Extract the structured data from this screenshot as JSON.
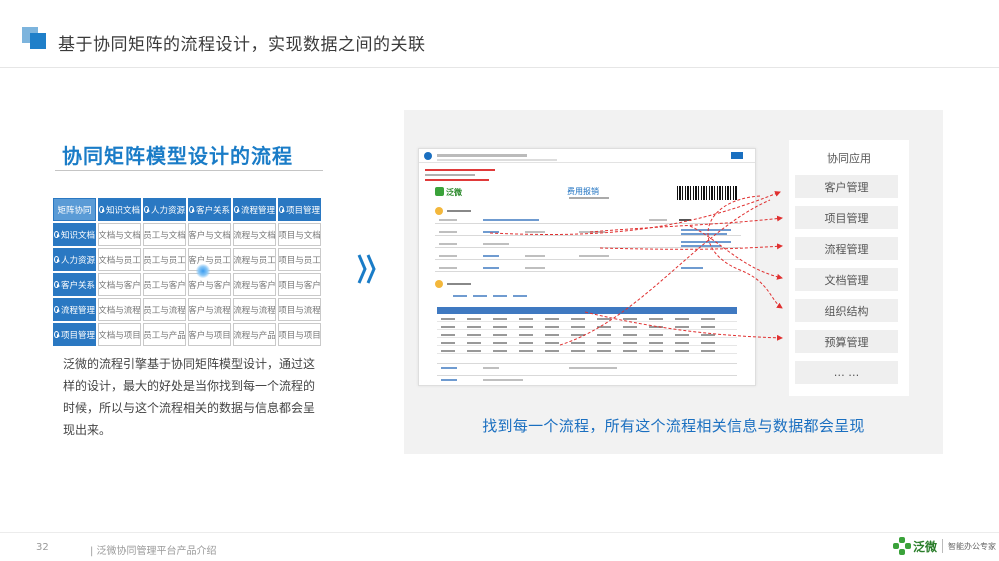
{
  "header": {
    "title": "基于协同矩阵的流程设计，实现数据之间的关联"
  },
  "left": {
    "section_title": "协同矩阵模型设计的流程",
    "matrix": [
      [
        "矩阵协同",
        "知识文档",
        "人力资源",
        "客户关系",
        "流程管理",
        "项目管理"
      ],
      [
        "知识文档",
        "文档与文档",
        "员工与文档",
        "客户与文档",
        "流程与文档",
        "项目与文档"
      ],
      [
        "人力资源",
        "文档与员工",
        "员工与员工",
        "客户与员工",
        "流程与员工",
        "项目与员工"
      ],
      [
        "客户关系",
        "文档与客户",
        "员工与客户",
        "客户与客户",
        "流程与客户",
        "项目与客户"
      ],
      [
        "流程管理",
        "文档与流程",
        "员工与流程",
        "客户与流程",
        "流程与流程",
        "项目与流程"
      ],
      [
        "项目管理",
        "文档与项目",
        "员工与产品",
        "客户与项目",
        "流程与产品",
        "项目与项目"
      ]
    ],
    "description": "泛微的流程引擎基于协同矩阵模型设计，通过这样的设计，最大的好处是当你找到每一个流程的时候，所以与这个流程相关的数据与信息都会呈现出来。"
  },
  "screenshot": {
    "logo_text": "泛微",
    "form_title": "费用报销"
  },
  "right": {
    "list_title": "协同应用",
    "items": [
      "客户管理",
      "项目管理",
      "流程管理",
      "文档管理",
      "组织结构",
      "预算管理",
      "… …"
    ],
    "caption": "找到每一个流程，所有这个流程相关信息与数据都会呈现"
  },
  "footer": {
    "page_number": "32",
    "title": "| 泛微协同管理平台产品介绍",
    "logo_text": "泛微",
    "slogan": "智能办公专家"
  },
  "colors": {
    "accent": "#1a7cc7",
    "matrix_header": "#2a78c2",
    "arrow": "#e03030",
    "logo_green": "#3aa23a"
  }
}
